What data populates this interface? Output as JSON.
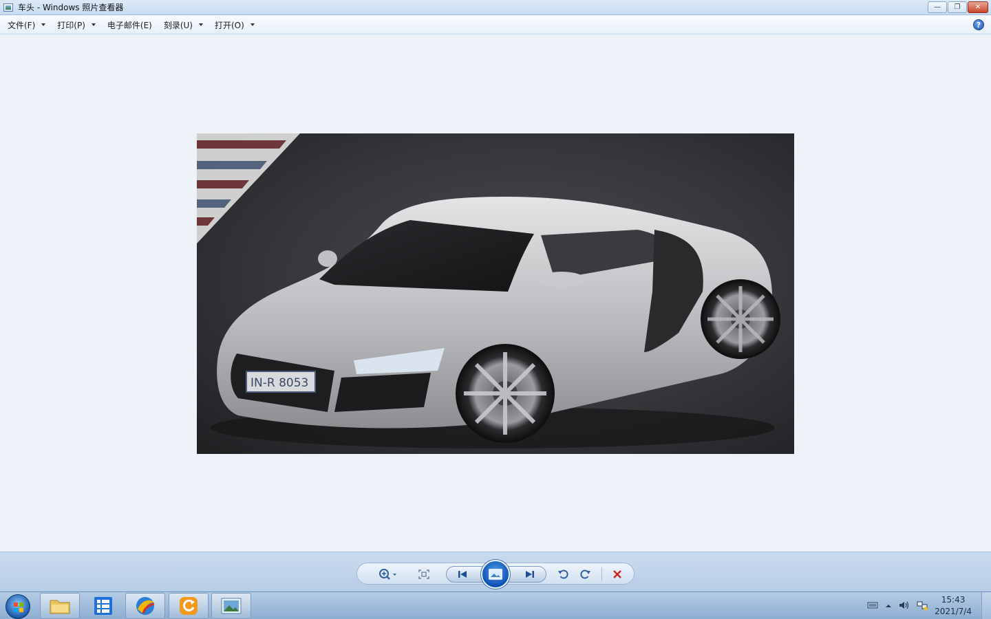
{
  "window": {
    "title": "车头 - Windows 照片查看器",
    "controls": {
      "minimize": "—",
      "restore": "❐",
      "close": "✕"
    }
  },
  "menu": {
    "items": [
      {
        "label": "文件(F)",
        "has_dropdown": true
      },
      {
        "label": "打印(P)",
        "has_dropdown": true
      },
      {
        "label": "电子邮件(E)",
        "has_dropdown": false
      },
      {
        "label": "刻录(U)",
        "has_dropdown": true
      },
      {
        "label": "打开(O)",
        "has_dropdown": true
      }
    ],
    "help": "?"
  },
  "photo": {
    "subject": "silver sports car front three-quarter view",
    "plate_text": "IN-R 8053"
  },
  "toolbar": {
    "buttons": [
      "zoom-icon",
      "actual-size-icon",
      "previous-icon",
      "slideshow-icon",
      "next-icon",
      "rotate-left-icon",
      "rotate-right-icon",
      "delete-icon"
    ]
  },
  "taskbar": {
    "apps": [
      "file-explorer",
      "app-grid",
      "browser",
      "refresh-app",
      "photo-viewer"
    ],
    "clock": {
      "time": "15:43",
      "date": "2021/7/4"
    }
  },
  "colors": {
    "accent": "#1f55b6",
    "delete": "#d0211a",
    "window_bg": "#eef3fa"
  }
}
